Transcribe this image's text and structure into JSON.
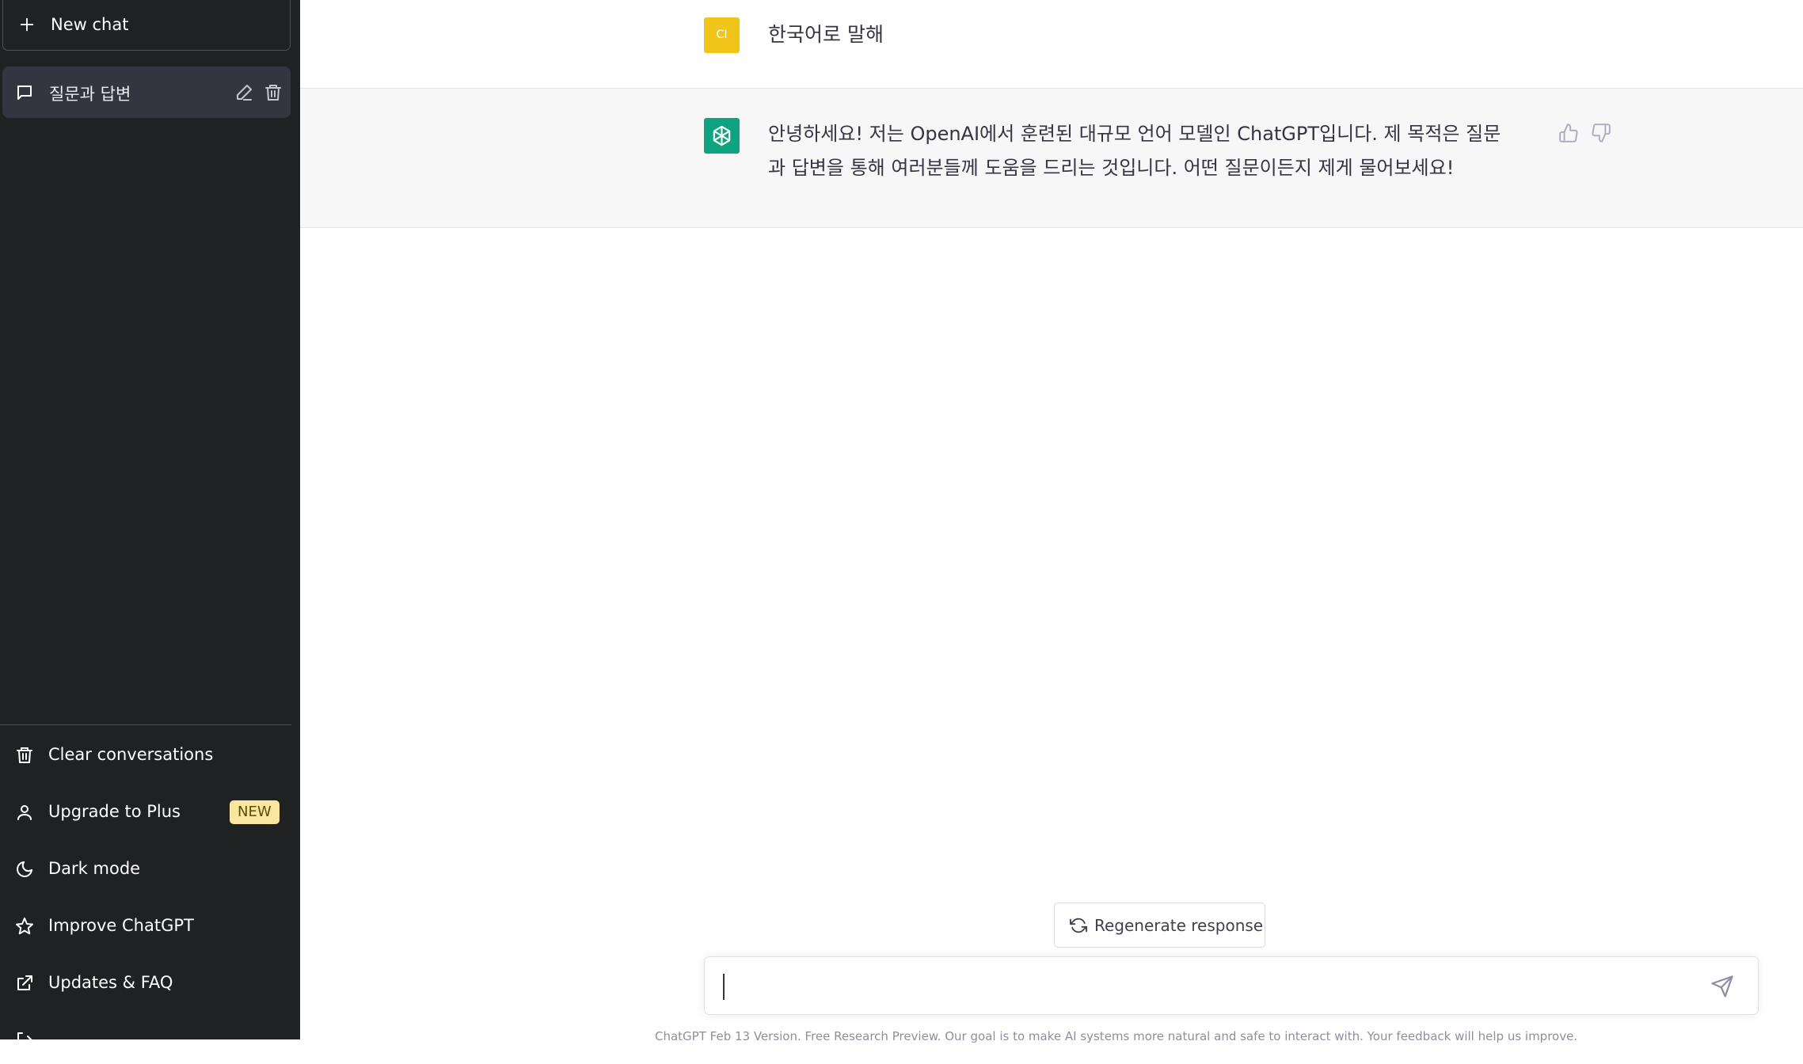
{
  "sidebar": {
    "new_chat_label": "New chat",
    "conversations": [
      {
        "title": "질문과 답변"
      }
    ],
    "menu": {
      "clear": "Clear conversations",
      "upgrade": "Upgrade to Plus",
      "upgrade_badge": "NEW",
      "dark_mode": "Dark mode",
      "improve": "Improve ChatGPT",
      "updates": "Updates & FAQ"
    }
  },
  "thread": {
    "user": {
      "avatar_initials": "CI",
      "message": "한국어로 말해"
    },
    "assistant": {
      "message_line1": "안녕하세요! 저는 OpenAI에서 훈련된 대규모 언어 모델인 ChatGPT입니다. 제 목적은 질문",
      "message_line2": "과 답변을 통해 여러분들께 도움을 드리는 것입니다. 어떤 질문이든지 제게 물어보세요!"
    }
  },
  "composer": {
    "regenerate_label": "Regenerate response",
    "input_value": ""
  },
  "footer": {
    "text": "ChatGPT Feb 13 Version. Free Research Preview. Our goal is to make AI systems more natural and safe to interact with. Your feedback will help us improve."
  },
  "colors": {
    "sidebar_bg": "#202123",
    "selected_conv_bg": "#343541",
    "user_avatar": "#f0c419",
    "assistant_avatar": "#10a37f",
    "assistant_row_bg": "#f7f7f8",
    "badge_bg": "#fae69e"
  }
}
